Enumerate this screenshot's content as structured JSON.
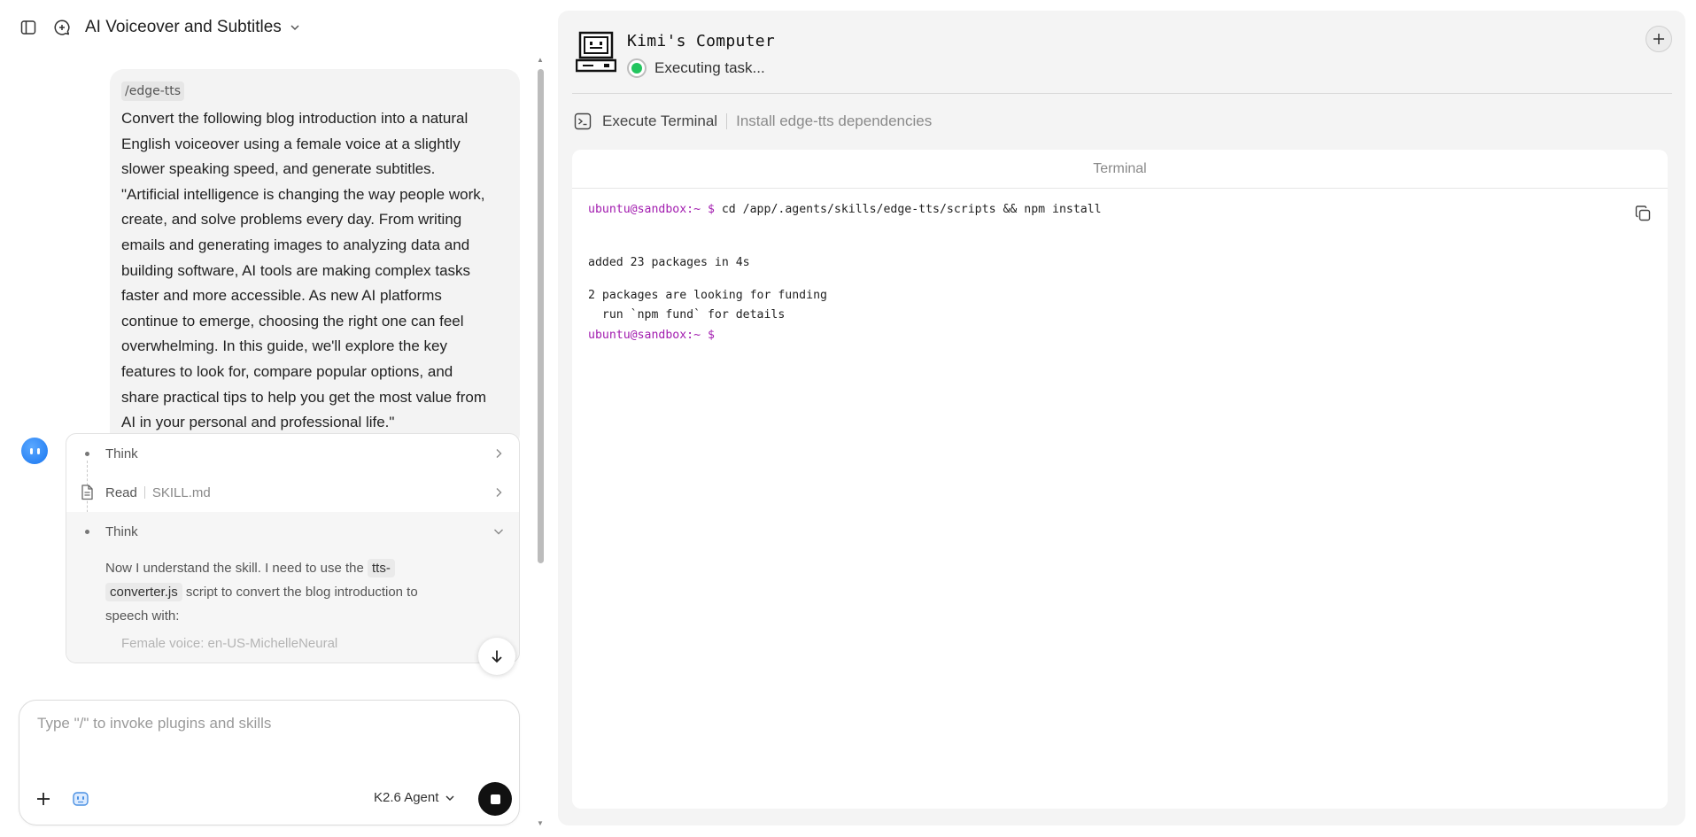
{
  "header": {
    "title": "AI Voiceover and Subtitles",
    "icons": [
      "sidebar-toggle-icon",
      "new-chat-icon",
      "chevron-down-icon"
    ]
  },
  "user_message": {
    "tag": "/edge-tts",
    "lines": [
      "Convert the following blog introduction into a natural",
      "English voiceover using a female voice at a slightly",
      "slower speaking speed, and generate subtitles.",
      "\"Artificial intelligence is changing the way people work,",
      "create, and solve problems every day. From writing",
      "emails and generating images to analyzing data and",
      "building software, AI tools are making complex tasks",
      "faster and more accessible. As new AI platforms",
      "continue to emerge, choosing the right one can feel",
      "overwhelming. In this guide, we'll explore the key",
      "features to look for, compare popular options, and",
      "share practical tips to help you get the most value from",
      "AI in your personal and professional life.\""
    ]
  },
  "steps": [
    {
      "label": "Think",
      "sub": ""
    },
    {
      "label": "Read",
      "sub": "SKILL.md"
    },
    {
      "label": "Think",
      "sub": ""
    }
  ],
  "think_body": {
    "pre": "Now I understand the skill. I need to use the",
    "code1a": "tts-",
    "code1b": "converter.js",
    "post1": "script to convert the blog introduction to",
    "post2": "speech with:",
    "faded": "Female voice: en-US-MichelleNeural"
  },
  "composer": {
    "placeholder": "Type \"/\" to invoke plugins and skills",
    "model": "K2.6 Agent"
  },
  "computer": {
    "name": "Kimi's Computer",
    "status": "Executing task...",
    "action": "Execute Terminal",
    "action_desc": "Install edge-tts dependencies",
    "status_color": "#22c55e"
  },
  "terminal": {
    "title": "Terminal",
    "prompt": "ubuntu@sandbox:~ $",
    "command": " cd /app/.agents/skills/edge-tts/scripts && npm install",
    "out1": "added 23 packages in 4s",
    "out2": "2 packages are looking for funding",
    "out3": "  run `npm fund` for details",
    "prompt_color": "#a21caf"
  }
}
